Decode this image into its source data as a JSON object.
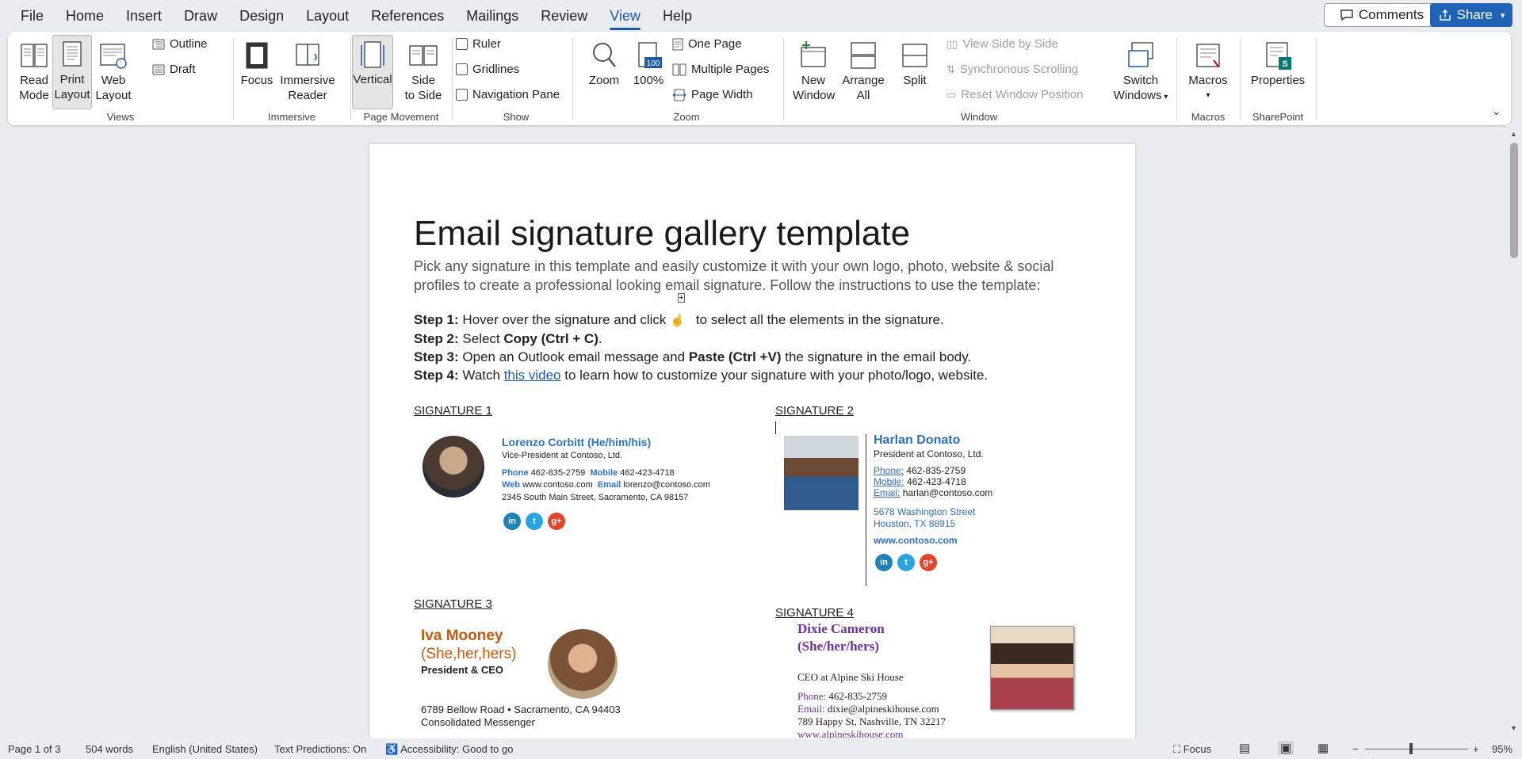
{
  "menu": {
    "tabs": [
      "File",
      "Home",
      "Insert",
      "Draw",
      "Design",
      "Layout",
      "References",
      "Mailings",
      "Review",
      "View",
      "Help"
    ],
    "active": "View",
    "comments": "Comments",
    "share": "Share"
  },
  "ribbon": {
    "views": {
      "read_mode": [
        "Read",
        "Mode"
      ],
      "print_layout": [
        "Print",
        "Layout"
      ],
      "web_layout": [
        "Web",
        "Layout"
      ],
      "outline": "Outline",
      "draft": "Draft",
      "group": "Views"
    },
    "immersive": {
      "focus": "Focus",
      "reader": [
        "Immersive",
        "Reader"
      ],
      "group": "Immersive"
    },
    "page_movement": {
      "vertical": "Vertical",
      "side": [
        "Side",
        "to Side"
      ],
      "group": "Page Movement"
    },
    "show": {
      "ruler": "Ruler",
      "gridlines": "Gridlines",
      "nav_pane": "Navigation Pane",
      "group": "Show"
    },
    "zoom": {
      "zoom": "Zoom",
      "pct": "100%",
      "one_page": "One Page",
      "multiple_pages": "Multiple Pages",
      "page_width": "Page Width",
      "group": "Zoom"
    },
    "window": {
      "new_window": [
        "New",
        "Window"
      ],
      "arrange_all": [
        "Arrange",
        "All"
      ],
      "split": "Split",
      "view_side": "View Side by Side",
      "sync_scroll": "Synchronous Scrolling",
      "reset_pos": "Reset Window Position",
      "switch": [
        "Switch",
        "Windows"
      ],
      "group": "Window"
    },
    "macros": {
      "label": "Macros",
      "group": "Macros"
    },
    "sharepoint": {
      "properties": "Properties",
      "group": "SharePoint"
    }
  },
  "doc": {
    "title": "Email signature gallery template",
    "intro1": "Pick any signature in this template and easily customize it with your own logo, photo, website & social",
    "intro2": "profiles to create a professional looking email signature. Follow the instructions to use the template:",
    "step1": {
      "label": "Step 1:",
      "a": " Hover over the signature and click ",
      "b": " to select all the elements in the signature."
    },
    "step2": {
      "label": "Step 2:",
      "a": " Select ",
      "bold": "Copy (Ctrl + C)",
      "b": "."
    },
    "step3": {
      "label": "Step 3:",
      "a": " Open an Outlook email message and ",
      "bold": "Paste (Ctrl +V)",
      "b": " the signature in the email body."
    },
    "step4": {
      "label": "Step 4:",
      "a": " Watch ",
      "link": "this video",
      "b": " to learn how to customize your signature with your photo/logo, website."
    },
    "sig1": {
      "head": "SIGNATURE 1",
      "name": "Lorenzo Corbitt (He/him/his)",
      "title": "Vice-President at Contoso, Ltd.",
      "phone_l": "Phone",
      "phone": "462-835-2759",
      "mobile_l": "Mobile",
      "mobile": "462-423-4718",
      "web_l": "Web",
      "web": "www.contoso.com",
      "email_l": "Email",
      "email": "lorenzo@contoso.com",
      "addr": "2345 South Main Street, Sacramento, CA 98157"
    },
    "sig2": {
      "head": "SIGNATURE 2",
      "name": "Harlan Donato",
      "title": "President at Contoso, Ltd.",
      "phone_l": "Phone:",
      "phone": "462-835-2759",
      "mobile_l": "Mobile:",
      "mobile": "462-423-4718",
      "email_l": "Email:",
      "email": "harlan@contoso.com",
      "addr1": "5678 Washington Street",
      "addr2": "Houston, TX 88915",
      "web": "www.contoso.com"
    },
    "sig3": {
      "head": "SIGNATURE 3",
      "name": "Iva Mooney",
      "pronouns": "(She,her,hers)",
      "title": "President & CEO",
      "addr": "6789 Bellow Road • Sacramento, CA 94403",
      "company": "Consolidated Messenger"
    },
    "sig4": {
      "head": "SIGNATURE 4",
      "name": "Dixie Cameron",
      "pronouns": "(She/her/hers)",
      "title": "CEO at Alpine Ski House",
      "phone_l": "Phone:",
      "phone": "462-835-2759",
      "email_l": "Email:",
      "email": "dixie@alpineskihouse.com",
      "addr": "789 Happy St, Nashville, TN 32217",
      "web": "www.alpineskihouse.com"
    },
    "social": {
      "linkedin": "in",
      "twitter": "t",
      "google": "g+"
    }
  },
  "status": {
    "page": "Page 1 of 3",
    "words": "504 words",
    "lang": "English (United States)",
    "predictions": "Text Predictions: On",
    "accessibility": "Accessibility: Good to go",
    "focus": "Focus",
    "zoom": "95%"
  },
  "colors": {
    "accent": "#1e5aa8",
    "sig1_blue": "#2f74c9",
    "sig3_orange": "#c55a11",
    "sig4_purple": "#7030a0"
  }
}
